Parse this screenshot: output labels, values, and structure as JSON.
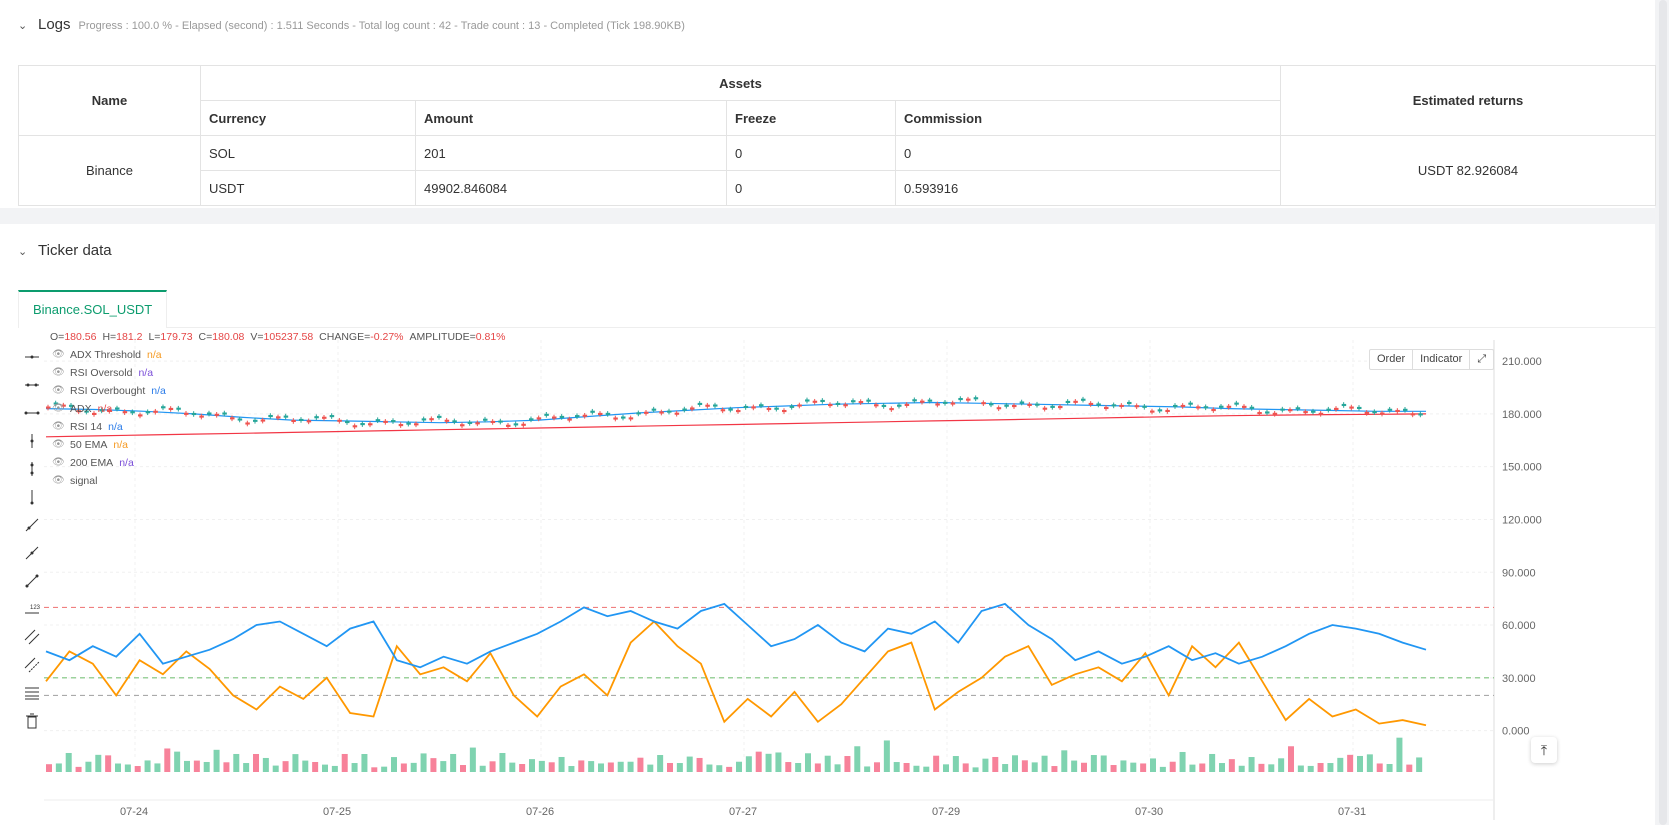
{
  "logs": {
    "title": "Logs",
    "status": "Progress : 100.0 % - Elapsed (second) : 1.511  Seconds - Total log count : 42 - Trade count : 13 - Completed (Tick 198.90KB)"
  },
  "assets_table": {
    "col_name": "Name",
    "col_assets": "Assets",
    "col_returns": "Estimated returns",
    "sub_currency": "Currency",
    "sub_amount": "Amount",
    "sub_freeze": "Freeze",
    "sub_commission": "Commission",
    "exchange": "Binance",
    "rows": [
      {
        "currency": "SOL",
        "amount": "201",
        "freeze": "0",
        "commission": "0"
      },
      {
        "currency": "USDT",
        "amount": "49902.846084",
        "freeze": "0",
        "commission": "0.593916"
      }
    ],
    "estimated_returns": "USDT 82.926084"
  },
  "ticker": {
    "title": "Ticker data",
    "tab": "Binance.SOL_USDT",
    "buttons": {
      "order": "Order",
      "indicator": "Indicator"
    }
  },
  "legend": {
    "ohlc": {
      "o_label": "O=",
      "o": "180.56",
      "h_label": "H=",
      "h": "181.2",
      "l_label": "L=",
      "l": "179.73",
      "c_label": "C=",
      "c": "180.08",
      "v_label": "V=",
      "v": "105237.58",
      "chg_label": "CHANGE=",
      "chg": "-0.27%",
      "amp_label": "AMPLITUDE=",
      "amp": "0.81%"
    },
    "items": [
      {
        "name": "ADX Threshold",
        "value": "n/a",
        "color": "orange"
      },
      {
        "name": "RSI Oversold",
        "value": "n/a",
        "color": "purple"
      },
      {
        "name": "RSI Overbought",
        "value": "n/a",
        "color": "blue"
      },
      {
        "name": "ADX",
        "value": "n/a",
        "color": "red"
      },
      {
        "name": "RSI 14",
        "value": "n/a",
        "color": "blue"
      },
      {
        "name": "50 EMA",
        "value": "n/a",
        "color": "orange"
      },
      {
        "name": "200 EMA",
        "value": "n/a",
        "color": "purple"
      },
      {
        "name": "signal",
        "value": "",
        "color": "none"
      }
    ]
  },
  "chart_data": {
    "type": "line",
    "x_ticks": [
      "07-24",
      "07-25",
      "07-26",
      "07-27",
      "07-29",
      "07-30",
      "07-31"
    ],
    "y_ticks": [
      "210.000",
      "180.000",
      "150.000",
      "120.000",
      "90.000",
      "60.000",
      "30.000",
      "0.000"
    ],
    "ylim": [
      -15,
      222
    ],
    "hlines": [
      {
        "name": "RSI Overbought",
        "value": 70,
        "color": "#f08080"
      },
      {
        "name": "RSI Oversold",
        "value": 30,
        "color": "#7cc47c"
      },
      {
        "name": "ADX Threshold",
        "value": 20,
        "color": "#aaaaaa"
      }
    ],
    "colors": {
      "up": "#26a69a",
      "down": "#ef5350",
      "ema50": "#2196f3",
      "ema200": "#f23645",
      "rsi": "#2196f3",
      "adx": "#ff9800",
      "vol_up": "#7fd3b0",
      "vol_down": "#f7829a"
    },
    "series": [
      {
        "name": "50 EMA",
        "values": [
          183,
          182.5,
          181.5,
          180,
          178,
          176.5,
          176,
          175.5,
          175,
          175.5,
          176.5,
          178.5,
          180.5,
          182,
          183.5,
          184.5,
          185.5,
          186,
          186.5,
          186,
          185.5,
          185,
          184.5,
          184,
          183,
          182.5,
          182,
          181.5,
          181.5
        ]
      },
      {
        "name": "200 EMA",
        "values": [
          167,
          167.5,
          168,
          168.5,
          169,
          169.5,
          170,
          170.5,
          171,
          171.5,
          172,
          172.5,
          173,
          173.5,
          174,
          174.5,
          175,
          175.5,
          176,
          176.5,
          177,
          177.5,
          178,
          178.5,
          179,
          179.3,
          179.6,
          179.8,
          180
        ]
      },
      {
        "name": "RSI 14",
        "values": [
          45,
          40,
          48,
          42,
          55,
          38,
          42,
          46,
          52,
          60,
          62,
          55,
          48,
          58,
          62,
          40,
          36,
          42,
          38,
          45,
          50,
          55,
          62,
          70,
          65,
          68,
          62,
          58,
          68,
          72,
          60,
          48,
          52,
          60,
          50,
          45,
          58,
          55,
          62,
          50,
          68,
          72,
          60,
          52,
          40,
          45,
          38,
          42,
          48,
          40,
          44,
          38,
          42,
          48,
          55,
          60,
          58,
          55,
          50,
          46
        ]
      },
      {
        "name": "ADX",
        "values": [
          28,
          45,
          38,
          20,
          40,
          32,
          45,
          35,
          20,
          12,
          25,
          18,
          30,
          10,
          8,
          48,
          32,
          36,
          28,
          44,
          20,
          8,
          25,
          32,
          20,
          50,
          62,
          48,
          38,
          5,
          18,
          8,
          22,
          5,
          15,
          30,
          45,
          50,
          12,
          22,
          30,
          42,
          48,
          26,
          32,
          36,
          28,
          44,
          20,
          48,
          36,
          50,
          28,
          6,
          18,
          8,
          12,
          4,
          6,
          3
        ]
      },
      {
        "name": "Volume",
        "values": [
          10,
          8,
          14,
          6,
          9,
          12,
          18,
          7,
          5,
          6,
          9,
          11,
          22,
          15,
          13,
          10,
          7,
          24,
          8,
          12,
          9,
          14,
          18,
          6,
          8,
          21,
          10,
          7,
          8,
          5,
          12,
          9,
          14,
          6,
          5,
          11,
          10,
          8,
          13,
          15,
          9,
          12,
          7,
          19,
          8,
          10,
          14,
          11,
          7,
          9,
          12,
          8,
          10,
          6,
          9,
          14,
          8,
          7,
          12,
          9
        ]
      }
    ]
  }
}
